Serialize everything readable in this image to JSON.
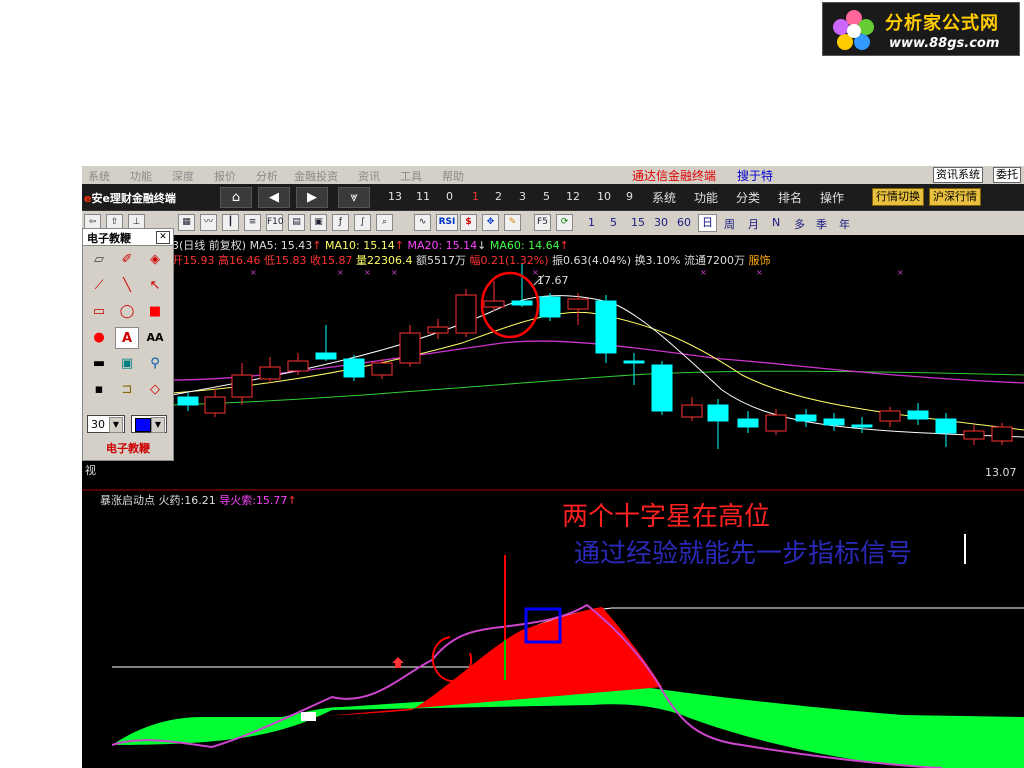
{
  "logo": {
    "title": "分析家公式网",
    "url": "www.88gs.com"
  },
  "menubar": {
    "items": [
      "系统",
      "功能",
      "深度",
      "报价",
      "分析",
      "金融投资",
      "资讯",
      "工具",
      "帮助"
    ],
    "center_red": "通达信金融终端",
    "center_blue": "搜于特",
    "right_buttons": [
      "资讯系统",
      "委托"
    ]
  },
  "toolbar1": {
    "brand_e": "e",
    "brand": "安e理财金融终端",
    "numbers": [
      "13",
      "11",
      "0",
      "1",
      "2",
      "3",
      "5",
      "12",
      "10",
      "9"
    ],
    "highlight_number": "1",
    "menus": [
      "系统",
      "功能",
      "分类",
      "排名",
      "操作"
    ],
    "right_buttons": [
      "行情切换",
      "沪深行情"
    ]
  },
  "toolbar2": {
    "icon_labels": [
      "F10",
      "F5",
      "RSI",
      "$"
    ],
    "periods": [
      "1",
      "5",
      "15",
      "30",
      "60",
      "日",
      "周",
      "月",
      "N",
      "多",
      "季",
      "年"
    ],
    "selected_period": "日"
  },
  "info": {
    "line1_title": "3(日线 前复权)",
    "ma5": "MA5: 15.43",
    "ma10": "MA10: 15.14",
    "ma20": "MA20: 15.14",
    "ma60": "MA60: 14.64",
    "arrow_up": "↑",
    "arrow_down": "↓",
    "line2_open": "开15.93",
    "line2_high": "高16.46",
    "line2_low": "低15.83",
    "line2_close": "收15.87",
    "line2_vol": "量22306.4",
    "line2_amt": "额5517万",
    "line2_pct": "幅0.21(1.32%)",
    "line2_amp": "振0.63(4.04%)",
    "line2_turn": "换3.10%",
    "line2_float": "流通7200万",
    "line2_ind": "服饰"
  },
  "chart": {
    "high_label": "17.67",
    "axis_value": "13.07",
    "left_label": "视"
  },
  "lower_panel": {
    "name": "暴涨启动点",
    "v1_label": "火药:",
    "v1": "16.21",
    "v2_label": "导火索:",
    "v2": "15.77",
    "arrow": "↑"
  },
  "annotations": {
    "line1": "两个十字星在高位",
    "line2": "通过经验就能先一步指标信号"
  },
  "palette": {
    "title": "电子教鞭",
    "size_value": "30",
    "footer": "电子教鞭"
  },
  "colors": {
    "candle_up": "#ff3333",
    "candle_down": "#00ffff",
    "ma5": "#ffffff",
    "ma10": "#ffff66",
    "ma20": "#cc33cc",
    "ma60": "#33cc33",
    "fill_red": "#ff0000",
    "fill_green": "#00ff33"
  }
}
